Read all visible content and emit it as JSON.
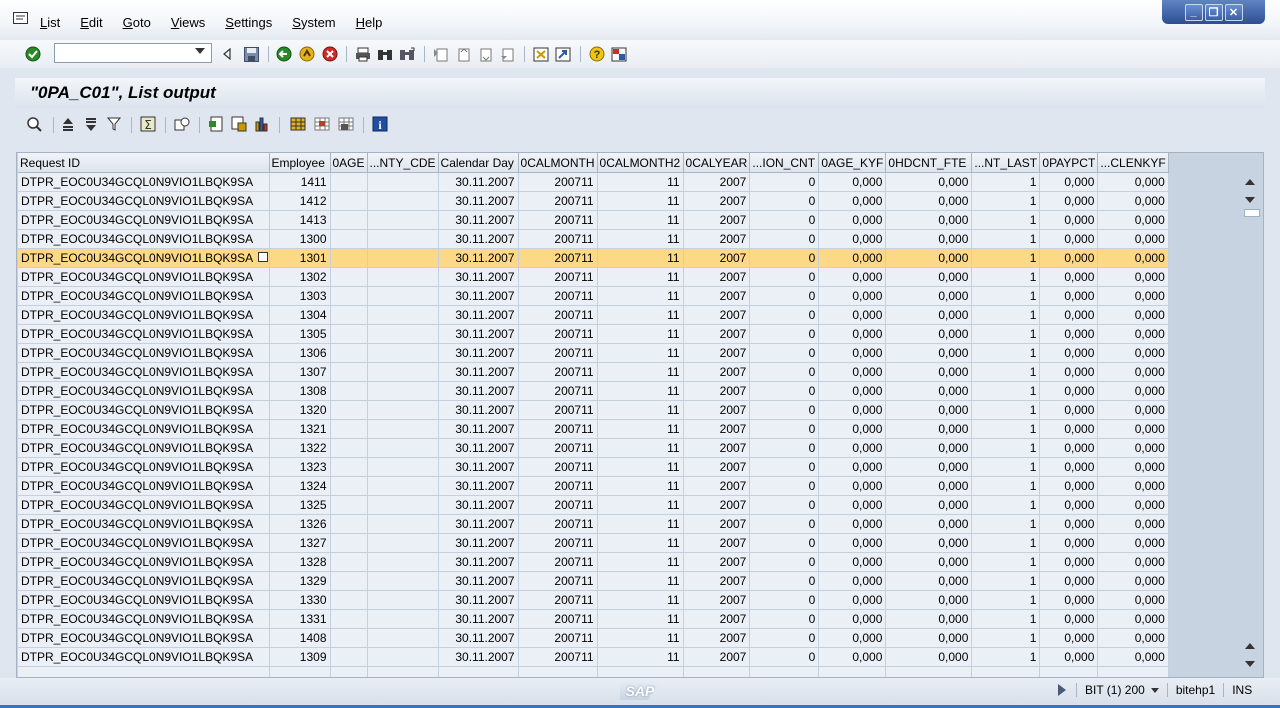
{
  "menu": {
    "items": [
      "List",
      "Edit",
      "Goto",
      "Views",
      "Settings",
      "System",
      "Help"
    ]
  },
  "toolbar": {
    "command_value": ""
  },
  "title": "\"0PA_C01\", List output",
  "grid": {
    "columns": [
      "Request ID",
      "Employee",
      "0AGE",
      "...NTY_CDE",
      "Calendar Day",
      "0CALMONTH",
      "0CALMONTH2",
      "0CALYEAR",
      "...ION_CNT",
      "0AGE_KYF",
      "0HDCNT_FTE",
      "...NT_LAST",
      "0PAYPCT",
      "...CLENKYF"
    ],
    "selected_row": 4,
    "rows": [
      [
        "DTPR_EOC0U34GCQL0N9VIO1LBQK9SA",
        "1411",
        "",
        "",
        "30.11.2007",
        "200711",
        "11",
        "2007",
        "0",
        "0,000",
        "0,000",
        "1",
        "0,000",
        "0,000"
      ],
      [
        "DTPR_EOC0U34GCQL0N9VIO1LBQK9SA",
        "1412",
        "",
        "",
        "30.11.2007",
        "200711",
        "11",
        "2007",
        "0",
        "0,000",
        "0,000",
        "1",
        "0,000",
        "0,000"
      ],
      [
        "DTPR_EOC0U34GCQL0N9VIO1LBQK9SA",
        "1413",
        "",
        "",
        "30.11.2007",
        "200711",
        "11",
        "2007",
        "0",
        "0,000",
        "0,000",
        "1",
        "0,000",
        "0,000"
      ],
      [
        "DTPR_EOC0U34GCQL0N9VIO1LBQK9SA",
        "1300",
        "",
        "",
        "30.11.2007",
        "200711",
        "11",
        "2007",
        "0",
        "0,000",
        "0,000",
        "1",
        "0,000",
        "0,000"
      ],
      [
        "DTPR_EOC0U34GCQL0N9VIO1LBQK9SA",
        "1301",
        "",
        "",
        "30.11.2007",
        "200711",
        "11",
        "2007",
        "0",
        "0,000",
        "0,000",
        "1",
        "0,000",
        "0,000"
      ],
      [
        "DTPR_EOC0U34GCQL0N9VIO1LBQK9SA",
        "1302",
        "",
        "",
        "30.11.2007",
        "200711",
        "11",
        "2007",
        "0",
        "0,000",
        "0,000",
        "1",
        "0,000",
        "0,000"
      ],
      [
        "DTPR_EOC0U34GCQL0N9VIO1LBQK9SA",
        "1303",
        "",
        "",
        "30.11.2007",
        "200711",
        "11",
        "2007",
        "0",
        "0,000",
        "0,000",
        "1",
        "0,000",
        "0,000"
      ],
      [
        "DTPR_EOC0U34GCQL0N9VIO1LBQK9SA",
        "1304",
        "",
        "",
        "30.11.2007",
        "200711",
        "11",
        "2007",
        "0",
        "0,000",
        "0,000",
        "1",
        "0,000",
        "0,000"
      ],
      [
        "DTPR_EOC0U34GCQL0N9VIO1LBQK9SA",
        "1305",
        "",
        "",
        "30.11.2007",
        "200711",
        "11",
        "2007",
        "0",
        "0,000",
        "0,000",
        "1",
        "0,000",
        "0,000"
      ],
      [
        "DTPR_EOC0U34GCQL0N9VIO1LBQK9SA",
        "1306",
        "",
        "",
        "30.11.2007",
        "200711",
        "11",
        "2007",
        "0",
        "0,000",
        "0,000",
        "1",
        "0,000",
        "0,000"
      ],
      [
        "DTPR_EOC0U34GCQL0N9VIO1LBQK9SA",
        "1307",
        "",
        "",
        "30.11.2007",
        "200711",
        "11",
        "2007",
        "0",
        "0,000",
        "0,000",
        "1",
        "0,000",
        "0,000"
      ],
      [
        "DTPR_EOC0U34GCQL0N9VIO1LBQK9SA",
        "1308",
        "",
        "",
        "30.11.2007",
        "200711",
        "11",
        "2007",
        "0",
        "0,000",
        "0,000",
        "1",
        "0,000",
        "0,000"
      ],
      [
        "DTPR_EOC0U34GCQL0N9VIO1LBQK9SA",
        "1320",
        "",
        "",
        "30.11.2007",
        "200711",
        "11",
        "2007",
        "0",
        "0,000",
        "0,000",
        "1",
        "0,000",
        "0,000"
      ],
      [
        "DTPR_EOC0U34GCQL0N9VIO1LBQK9SA",
        "1321",
        "",
        "",
        "30.11.2007",
        "200711",
        "11",
        "2007",
        "0",
        "0,000",
        "0,000",
        "1",
        "0,000",
        "0,000"
      ],
      [
        "DTPR_EOC0U34GCQL0N9VIO1LBQK9SA",
        "1322",
        "",
        "",
        "30.11.2007",
        "200711",
        "11",
        "2007",
        "0",
        "0,000",
        "0,000",
        "1",
        "0,000",
        "0,000"
      ],
      [
        "DTPR_EOC0U34GCQL0N9VIO1LBQK9SA",
        "1323",
        "",
        "",
        "30.11.2007",
        "200711",
        "11",
        "2007",
        "0",
        "0,000",
        "0,000",
        "1",
        "0,000",
        "0,000"
      ],
      [
        "DTPR_EOC0U34GCQL0N9VIO1LBQK9SA",
        "1324",
        "",
        "",
        "30.11.2007",
        "200711",
        "11",
        "2007",
        "0",
        "0,000",
        "0,000",
        "1",
        "0,000",
        "0,000"
      ],
      [
        "DTPR_EOC0U34GCQL0N9VIO1LBQK9SA",
        "1325",
        "",
        "",
        "30.11.2007",
        "200711",
        "11",
        "2007",
        "0",
        "0,000",
        "0,000",
        "1",
        "0,000",
        "0,000"
      ],
      [
        "DTPR_EOC0U34GCQL0N9VIO1LBQK9SA",
        "1326",
        "",
        "",
        "30.11.2007",
        "200711",
        "11",
        "2007",
        "0",
        "0,000",
        "0,000",
        "1",
        "0,000",
        "0,000"
      ],
      [
        "DTPR_EOC0U34GCQL0N9VIO1LBQK9SA",
        "1327",
        "",
        "",
        "30.11.2007",
        "200711",
        "11",
        "2007",
        "0",
        "0,000",
        "0,000",
        "1",
        "0,000",
        "0,000"
      ],
      [
        "DTPR_EOC0U34GCQL0N9VIO1LBQK9SA",
        "1328",
        "",
        "",
        "30.11.2007",
        "200711",
        "11",
        "2007",
        "0",
        "0,000",
        "0,000",
        "1",
        "0,000",
        "0,000"
      ],
      [
        "DTPR_EOC0U34GCQL0N9VIO1LBQK9SA",
        "1329",
        "",
        "",
        "30.11.2007",
        "200711",
        "11",
        "2007",
        "0",
        "0,000",
        "0,000",
        "1",
        "0,000",
        "0,000"
      ],
      [
        "DTPR_EOC0U34GCQL0N9VIO1LBQK9SA",
        "1330",
        "",
        "",
        "30.11.2007",
        "200711",
        "11",
        "2007",
        "0",
        "0,000",
        "0,000",
        "1",
        "0,000",
        "0,000"
      ],
      [
        "DTPR_EOC0U34GCQL0N9VIO1LBQK9SA",
        "1331",
        "",
        "",
        "30.11.2007",
        "200711",
        "11",
        "2007",
        "0",
        "0,000",
        "0,000",
        "1",
        "0,000",
        "0,000"
      ],
      [
        "DTPR_EOC0U34GCQL0N9VIO1LBQK9SA",
        "1408",
        "",
        "",
        "30.11.2007",
        "200711",
        "11",
        "2007",
        "0",
        "0,000",
        "0,000",
        "1",
        "0,000",
        "0,000"
      ],
      [
        "DTPR_EOC0U34GCQL0N9VIO1LBQK9SA",
        "1309",
        "",
        "",
        "30.11.2007",
        "200711",
        "11",
        "2007",
        "0",
        "0,000",
        "0,000",
        "1",
        "0,000",
        "0,000"
      ]
    ]
  },
  "status": {
    "system": "BIT (1) 200",
    "server": "bitehp1",
    "mode": "INS"
  },
  "icons": {
    "menu_system": "sap-menu-icon",
    "enter": "check-icon",
    "save": "save-icon",
    "back": "back-icon",
    "exit": "exit-icon",
    "cancel": "cancel-icon",
    "print": "print-icon",
    "find": "find-icon",
    "help": "help-icon"
  },
  "colors": {
    "selection": "#fdd886",
    "grid_cell": "#ebf0f6",
    "window_control": "#2c4f93"
  }
}
